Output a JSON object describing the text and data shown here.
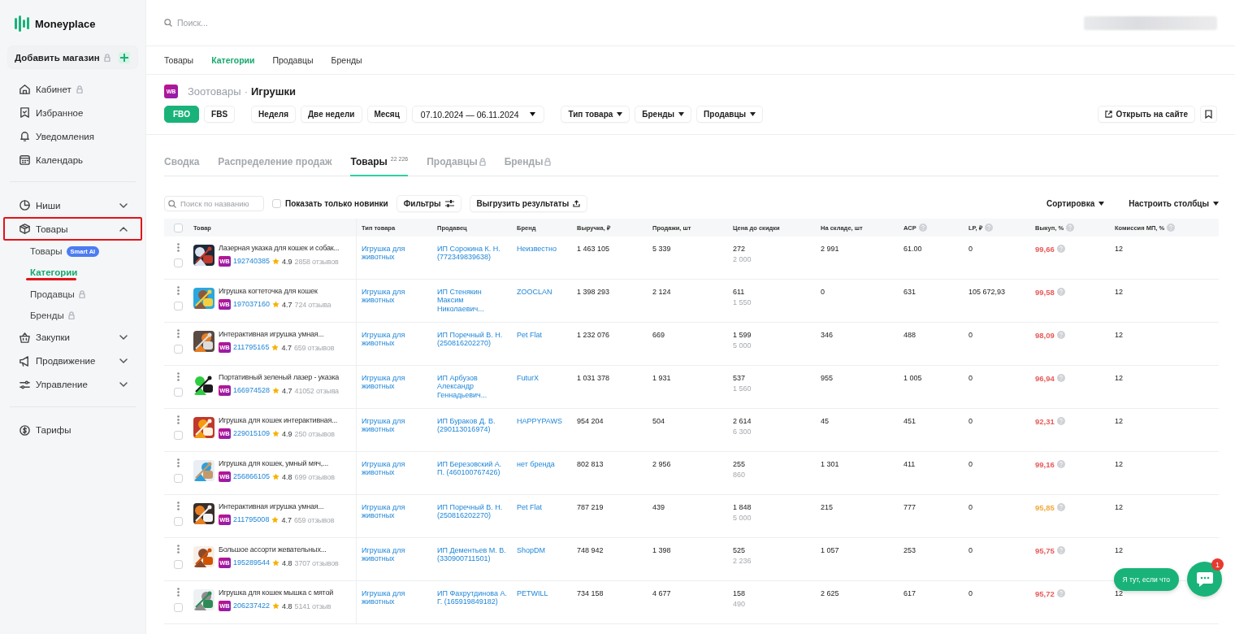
{
  "sidebar": {
    "logo": "Moneyplace",
    "add_store": {
      "label": "Добавить магазин",
      "locked": true
    },
    "sections": [
      {
        "items": [
          {
            "label": "Кабинет",
            "locked": true
          },
          {
            "label": "Избранное",
            "locked": false
          },
          {
            "label": "Уведомления",
            "locked": false
          },
          {
            "label": "Календарь",
            "locked": false
          }
        ]
      },
      {
        "items": [
          {
            "label": "Ниши",
            "locked": false,
            "expanded": false,
            "highlighted": false
          },
          {
            "label": "Товары",
            "locked": false,
            "expanded": true,
            "highlighted": true,
            "children": [
              {
                "label": "Товары",
                "badge": "Smart AI",
                "locked": false,
                "selected": false,
                "underlined": false
              },
              {
                "label": "Категории",
                "locked": false,
                "selected": true,
                "underlined": true
              },
              {
                "label": "Продавцы",
                "locked": true,
                "selected": false,
                "underlined": false
              },
              {
                "label": "Бренды",
                "locked": true,
                "selected": false,
                "underlined": false
              }
            ]
          },
          {
            "label": "Закупки",
            "locked": false,
            "expanded": false,
            "highlighted": false
          },
          {
            "label": "Продвижение",
            "locked": false,
            "expanded": false,
            "highlighted": false
          },
          {
            "label": "Управление",
            "locked": false,
            "expanded": false,
            "highlighted": false
          }
        ]
      },
      {
        "items": [
          {
            "label": "Тарифы",
            "locked": false
          }
        ]
      }
    ]
  },
  "topbar": {
    "search": {
      "placeholder": "Поиск..."
    }
  },
  "subnav": [
    {
      "label": "Товары",
      "selected": false
    },
    {
      "label": "Категории",
      "selected": true
    },
    {
      "label": "Продавцы",
      "selected": false
    },
    {
      "label": "Бренды",
      "selected": false
    }
  ],
  "header": {
    "marketplace": "WB",
    "parent": "Зоотовары",
    "separator": "·",
    "title": "Игрушки"
  },
  "filters": {
    "schemes": [
      {
        "label": "FBO",
        "selected": true
      },
      {
        "label": "FBS",
        "selected": false
      }
    ],
    "periods": [
      {
        "label": "Неделя",
        "selected": false
      },
      {
        "label": "Две недели",
        "selected": false
      },
      {
        "label": "Месяц",
        "selected": false
      }
    ],
    "date_range": "07.10.2024 — 06.11.2024",
    "dropdowns": [
      "Тип товара",
      "Бренды",
      "Продавцы"
    ],
    "open_site": "Открыть на сайте"
  },
  "tabs": [
    {
      "label": "Сводка",
      "selected": false,
      "locked": false
    },
    {
      "label": "Распределение продаж",
      "selected": false,
      "locked": false
    },
    {
      "label": "Товары",
      "count": "22 226",
      "selected": true,
      "locked": false
    },
    {
      "label": "Продавцы",
      "selected": false,
      "locked": true
    },
    {
      "label": "Бренды",
      "selected": false,
      "locked": true
    }
  ],
  "toolbar": {
    "search": {
      "placeholder": "Поиск по названию"
    },
    "new_only": {
      "label": "Показать только новинки",
      "checked": false
    },
    "filters": "Фильтры",
    "export": "Выгрузить результаты",
    "sort": "Сортировка",
    "columns": "Настроить столбцы"
  },
  "table": {
    "all_checked": false,
    "columns": [
      {
        "label": "Товар",
        "help": false
      },
      {
        "label": "Тип товара",
        "help": false
      },
      {
        "label": "Продавец",
        "help": false
      },
      {
        "label": "Бренд",
        "help": false
      },
      {
        "label": "Выручка, ₽",
        "help": false
      },
      {
        "label": "Продажи, шт",
        "help": false
      },
      {
        "label": "Цена до скидки",
        "help": false
      },
      {
        "label": "На складе, шт",
        "help": false
      },
      {
        "label": "АСР",
        "help": true
      },
      {
        "label": "LP, ₽",
        "help": true
      },
      {
        "label": "Выкуп, %",
        "help": true
      },
      {
        "label": "Комиссия МП, %",
        "help": true
      }
    ],
    "rows": [
      {
        "checked": false,
        "name": "Лазерная указка для кошек и собак...",
        "marketplace": "WB",
        "id": "192740385",
        "rating": "4.9",
        "reviews": "2858 отзывов",
        "type": "Игрушка для животных",
        "seller": "ИП Сорокина К. Н. (772349839638)",
        "brand": "Неизвестно",
        "revenue": "1 463 105",
        "sales": "5 339",
        "price": "272",
        "old_price": "2 000",
        "stock": "2 991",
        "acp": "61.00",
        "lp": "0",
        "buyout": "99,66",
        "color": "#e85a5a",
        "commission": "12"
      },
      {
        "checked": false,
        "name": "Игрушка когтеточка для кошек",
        "marketplace": "WB",
        "id": "197037160",
        "rating": "4.7",
        "reviews": "724 отзыва",
        "type": "Игрушка для животных",
        "seller": "ИП Стенякин Максим Николаевич...",
        "brand": "ZOOCLAN",
        "revenue": "1 398 293",
        "sales": "2 124",
        "price": "611",
        "old_price": "1 550",
        "stock": "0",
        "acp": "631",
        "lp": "105 672,93",
        "buyout": "99,58",
        "color": "#e85a5a",
        "commission": "12"
      },
      {
        "checked": false,
        "name": "Интерактивная игрушка умная...",
        "marketplace": "WB",
        "id": "211795165",
        "rating": "4.7",
        "reviews": "659 отзывов",
        "type": "Игрушка для животных",
        "seller": "ИП Поречный В. Н. (250816202270)",
        "brand": "Pet Flat",
        "revenue": "1 232 076",
        "sales": "669",
        "price": "1 599",
        "old_price": "5 000",
        "stock": "346",
        "acp": "488",
        "lp": "0",
        "buyout": "98,09",
        "color": "#e85a5a",
        "commission": "12"
      },
      {
        "checked": false,
        "name": "Портативный зеленый лазер - указка",
        "marketplace": "WB",
        "id": "166974528",
        "rating": "4.7",
        "reviews": "41052 отзыва",
        "type": "Игрушка для животных",
        "seller": "ИП Арбузов Александр Геннадьевич...",
        "brand": "FuturX",
        "revenue": "1 031 378",
        "sales": "1 931",
        "price": "537",
        "old_price": "1 560",
        "stock": "955",
        "acp": "1 005",
        "lp": "0",
        "buyout": "96,94",
        "color": "#e85a5a",
        "commission": "12"
      },
      {
        "checked": false,
        "name": "Игрушка для кошек интерактивная...",
        "marketplace": "WB",
        "id": "229015109",
        "rating": "4.9",
        "reviews": "250 отзывов",
        "type": "Игрушка для животных",
        "seller": "ИП Бураков Д. В. (290113016974)",
        "brand": "HAPPYPAWS",
        "revenue": "954 204",
        "sales": "504",
        "price": "2 614",
        "old_price": "6 300",
        "stock": "45",
        "acp": "451",
        "lp": "0",
        "buyout": "92,31",
        "color": "#e85a5a",
        "commission": "12"
      },
      {
        "checked": false,
        "name": "Игрушка для кошек, умный мяч,...",
        "marketplace": "WB",
        "id": "256866105",
        "rating": "4.8",
        "reviews": "699 отзывов",
        "type": "Игрушка для животных",
        "seller": "ИП Березовский А. П. (460100767426)",
        "brand": "нет бренда",
        "revenue": "802 813",
        "sales": "2 956",
        "price": "255",
        "old_price": "860",
        "stock": "1 301",
        "acp": "411",
        "lp": "0",
        "buyout": "99,16",
        "color": "#e85a5a",
        "commission": "12"
      },
      {
        "checked": false,
        "name": "Интерактивная игрушка умная...",
        "marketplace": "WB",
        "id": "211795008",
        "rating": "4.7",
        "reviews": "659 отзывов",
        "type": "Игрушка для животных",
        "seller": "ИП Поречный В. Н. (250816202270)",
        "brand": "Pet Flat",
        "revenue": "787 219",
        "sales": "439",
        "price": "1 848",
        "old_price": "5 000",
        "stock": "215",
        "acp": "777",
        "lp": "0",
        "buyout": "95,85",
        "color": "#f2a93b",
        "commission": "12"
      },
      {
        "checked": false,
        "name": "Большое ассорти жевательных...",
        "marketplace": "WB",
        "id": "195289544",
        "rating": "4.8",
        "reviews": "3707 отзывов",
        "type": "Игрушка для животных",
        "seller": "ИП Дементьев М. В. (330900711501)",
        "brand": "ShopDM",
        "revenue": "748 942",
        "sales": "1 398",
        "price": "525",
        "old_price": "2 236",
        "stock": "1 057",
        "acp": "253",
        "lp": "0",
        "buyout": "95,75",
        "color": "#e85a5a",
        "commission": "12"
      },
      {
        "checked": false,
        "name": "Игрушка для кошек мышка с мятой",
        "marketplace": "WB",
        "id": "206237422",
        "rating": "4.8",
        "reviews": "5141 отзыв",
        "type": "Игрушка для животных",
        "seller": "ИП Фахрутдинова А. Г. (165919849182)",
        "brand": "PETWILL",
        "revenue": "734 158",
        "sales": "4 677",
        "price": "158",
        "old_price": "490",
        "stock": "2 625",
        "acp": "617",
        "lp": "0",
        "buyout": "95,72",
        "color": "#e85a5a",
        "commission": "12"
      }
    ]
  },
  "chat": {
    "hint": "Я тут, если что",
    "unread": "1"
  }
}
